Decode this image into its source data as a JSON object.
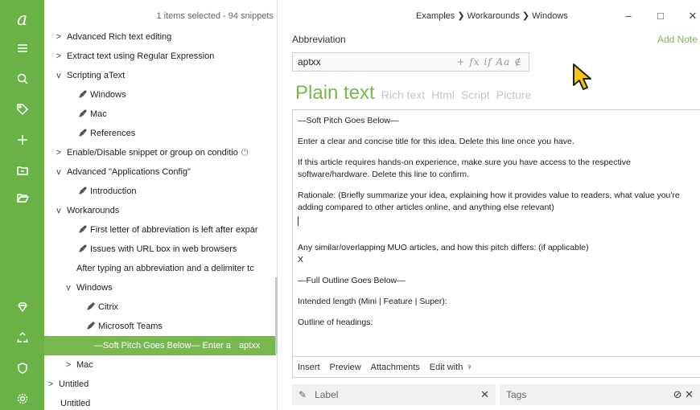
{
  "tree": {
    "header": "1 items selected - 94 snippets",
    "rows": [
      {
        "label": "Advanced Rich text editing",
        "chev": ">"
      },
      {
        "label": "Extract text using Regular Expression",
        "chev": ">"
      },
      {
        "label": "Scripting aText",
        "chev": "v"
      },
      {
        "label": "Windows"
      },
      {
        "label": "Mac"
      },
      {
        "label": "References"
      },
      {
        "label": "Enable/Disable snippet or group on conditio",
        "chev": ">"
      },
      {
        "label": "Advanced \"Applications Config\"",
        "chev": "v"
      },
      {
        "label": "Introduction"
      },
      {
        "label": "Workarounds",
        "chev": "v"
      },
      {
        "label": "First letter of abbreviation is left after expar"
      },
      {
        "label": "Issues with URL box in web browsers"
      },
      {
        "label": "After typing an abbreviation and a delimiter tc"
      },
      {
        "label": "Windows",
        "chev": "v"
      },
      {
        "label": "Citrix"
      },
      {
        "label": "Microsoft Teams"
      },
      {
        "label": "—Soft Pitch Goes Below— Enter a",
        "abbr": "aptxx"
      },
      {
        "label": "Mac",
        "chev": ">"
      },
      {
        "label": "Untitled",
        "chev": ">"
      },
      {
        "label": "Untitled"
      }
    ]
  },
  "editor": {
    "breadcrumb": "Examples ❯ Workarounds ❯ Windows",
    "window_buttons": {
      "minimize": "–",
      "maximize": "□",
      "close": "✕"
    },
    "abbreviation_label": "Abbreviation",
    "add_note": "Add Note",
    "abbreviation_value": "aptxx",
    "abbr_tools": "+ fx if Aa ∉",
    "content_types": {
      "active": "Plain text",
      "others": [
        "Rich text",
        "Html",
        "Script",
        "Picture"
      ]
    },
    "content_lines": [
      "—Soft Pitch Goes Below—",
      "Enter a clear and concise title for this idea. Delete this line once you have.",
      "If this article requires hands-on experience, make sure you have access to the respective software/hardware. Delete this line to confirm.",
      "Rationale: (Briefly summarize your idea, explaining how it provides value to readers, what value you're adding compared to other articles online, and anything else relevant)",
      "Any similar/overlapping MUO articles, and how this pitch differs: (if applicable)",
      "X",
      "—Full Outline Goes Below—",
      "Intended length (Mini | Feature | Super):",
      "Outline of headings:"
    ],
    "bottom_bar": [
      "Insert",
      "Preview",
      "Attachments",
      "Edit with"
    ],
    "label_placeholder": "Label",
    "tags_placeholder": "Tags"
  }
}
